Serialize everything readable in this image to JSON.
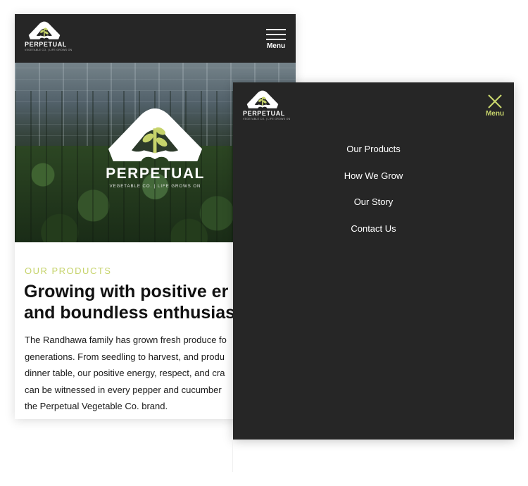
{
  "brand": {
    "name": "PERPETUAL",
    "tagline": "VEGETABLE CO. | LIFE GROWS ON",
    "colors": {
      "dark": "#262626",
      "accent": "#c6d36b",
      "leaf": "#c6d36b"
    }
  },
  "mobile_header": {
    "menu_label": "Menu",
    "icon": "hamburger-icon"
  },
  "content": {
    "eyebrow": "OUR PRODUCTS",
    "headline_lines": [
      "Growing with positive er",
      "and boundless enthusias"
    ],
    "body_lines": [
      "The Randhawa family has grown fresh produce fo",
      "generations. From seedling to harvest, and produ",
      "dinner table, our positive energy, respect, and cra",
      "can be witnessed in every pepper and cucumber",
      "the Perpetual Vegetable Co. brand."
    ]
  },
  "menu_overlay": {
    "close_label": "Menu",
    "icon": "close-icon",
    "items": [
      {
        "label": "Our Products"
      },
      {
        "label": "How We Grow"
      },
      {
        "label": "Our Story"
      },
      {
        "label": "Contact Us"
      }
    ]
  }
}
